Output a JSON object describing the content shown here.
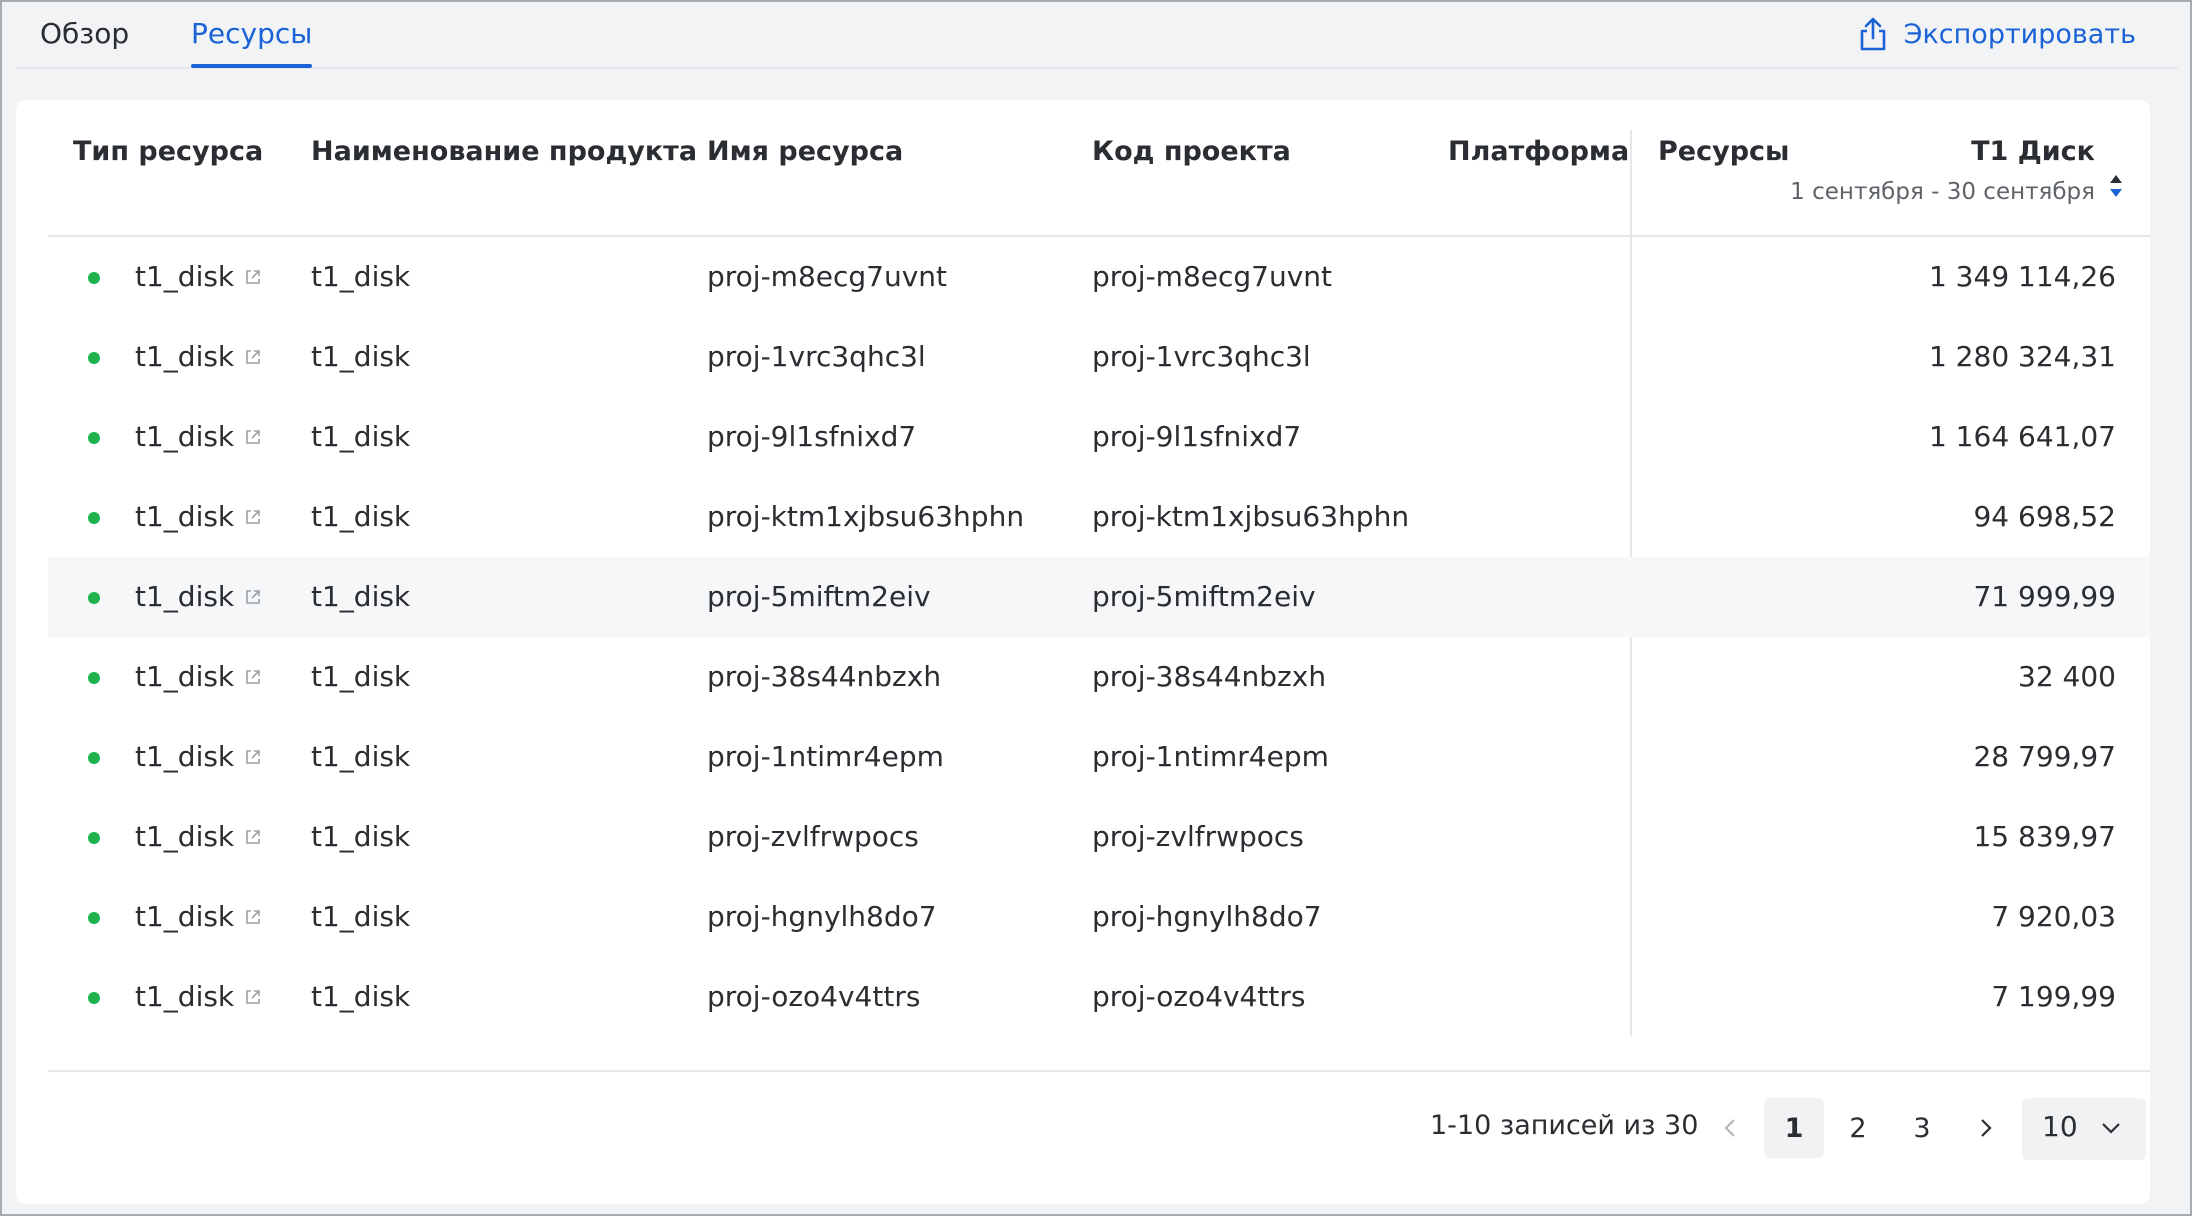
{
  "tabs": [
    {
      "label": "Обзор",
      "active": false
    },
    {
      "label": "Ресурсы",
      "active": true
    }
  ],
  "export_label": "Экспортировать",
  "table": {
    "headers": {
      "resource_type": "Тип ресурса",
      "product_name": "Наименование продукта",
      "resource_name": "Имя ресурса",
      "project_code": "Код проекта",
      "platform": "Платформа",
      "resources": "Ресурсы",
      "t1disk": "Т1 Диск",
      "t1disk_period": "1 сентября - 30 сентября"
    },
    "rows": [
      {
        "type": "t1_disk",
        "product": "t1_disk",
        "name": "proj-m8ecg7uvnt",
        "code": "proj-m8ecg7uvnt",
        "platform": "",
        "value": "1 349 114,26"
      },
      {
        "type": "t1_disk",
        "product": "t1_disk",
        "name": "proj-1vrc3qhc3l",
        "code": "proj-1vrc3qhc3l",
        "platform": "",
        "value": "1 280 324,31"
      },
      {
        "type": "t1_disk",
        "product": "t1_disk",
        "name": "proj-9l1sfnixd7",
        "code": "proj-9l1sfnixd7",
        "platform": "",
        "value": "1 164 641,07"
      },
      {
        "type": "t1_disk",
        "product": "t1_disk",
        "name": "proj-ktm1xjbsu63hphn",
        "code": "proj-ktm1xjbsu63hphn",
        "platform": "",
        "value": "94 698,52"
      },
      {
        "type": "t1_disk",
        "product": "t1_disk",
        "name": "proj-5miftm2eiv",
        "code": "proj-5miftm2eiv",
        "platform": "",
        "value": "71 999,99"
      },
      {
        "type": "t1_disk",
        "product": "t1_disk",
        "name": "proj-38s44nbzxh",
        "code": "proj-38s44nbzxh",
        "platform": "",
        "value": "32 400"
      },
      {
        "type": "t1_disk",
        "product": "t1_disk",
        "name": "proj-1ntimr4epm",
        "code": "proj-1ntimr4epm",
        "platform": "",
        "value": "28 799,97"
      },
      {
        "type": "t1_disk",
        "product": "t1_disk",
        "name": "proj-zvlfrwpocs",
        "code": "proj-zvlfrwpocs",
        "platform": "",
        "value": "15 839,97"
      },
      {
        "type": "t1_disk",
        "product": "t1_disk",
        "name": "proj-hgnylh8do7",
        "code": "proj-hgnylh8do7",
        "platform": "",
        "value": "7 920,03"
      },
      {
        "type": "t1_disk",
        "product": "t1_disk",
        "name": "proj-ozo4v4ttrs",
        "code": "proj-ozo4v4ttrs",
        "platform": "",
        "value": "7 199,99"
      }
    ]
  },
  "pagination": {
    "info": "1-10 записей из 30",
    "pages": [
      "1",
      "2",
      "3"
    ],
    "current": "1",
    "page_size": "10"
  },
  "colors": {
    "accent": "#1a63d6",
    "status_dot": "#1fb34f"
  },
  "icons": {
    "export": "export-icon",
    "external_link": "external-link-icon",
    "sort": "sort-icon",
    "prev": "chevron-left-icon",
    "next": "chevron-right-icon",
    "dropdown": "chevron-down-icon"
  }
}
